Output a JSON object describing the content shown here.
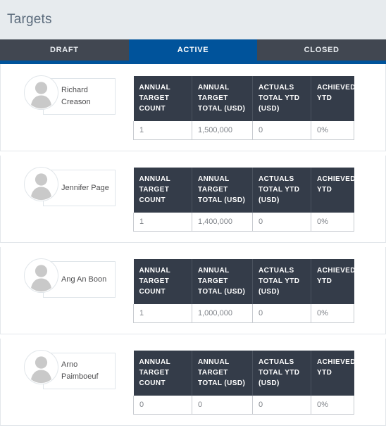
{
  "header": {
    "title": "Targets"
  },
  "tabs": [
    {
      "label": "DRAFT",
      "active": false
    },
    {
      "label": "ACTIVE",
      "active": true
    },
    {
      "label": "CLOSED",
      "active": false
    }
  ],
  "table": {
    "columns": [
      "ANNUAL TARGET COUNT",
      "ANNUAL TARGET TOTAL (USD)",
      "ACTUALS TOTAL YTD (USD)",
      "ACHIEVED YTD"
    ]
  },
  "records": [
    {
      "name": "Richard Creason",
      "avatar_icon": "person-avatar-icon",
      "annual_target_count": "1",
      "annual_target_total_usd": "1,500,000",
      "actuals_total_ytd_usd": "0",
      "achieved_ytd": "0%"
    },
    {
      "name": "Jennifer Page",
      "avatar_icon": "person-avatar-icon",
      "annual_target_count": "1",
      "annual_target_total_usd": "1,400,000",
      "actuals_total_ytd_usd": "0",
      "achieved_ytd": "0%"
    },
    {
      "name": "Ang An Boon",
      "avatar_icon": "person-avatar-icon",
      "annual_target_count": "1",
      "annual_target_total_usd": "1,000,000",
      "actuals_total_ytd_usd": "0",
      "achieved_ytd": "0%"
    },
    {
      "name": "Arno Paimboeuf",
      "avatar_icon": "person-avatar-icon",
      "annual_target_count": "0",
      "annual_target_total_usd": "0",
      "actuals_total_ytd_usd": "0",
      "achieved_ytd": "0%"
    }
  ],
  "colors": {
    "accent_blue": "#00539b",
    "tab_dark": "#414751",
    "table_header_dark": "#343c49",
    "page_header_bg": "#e7ebee",
    "title_text": "#5b6b7c",
    "cell_text": "#7f8389",
    "name_text": "#4d4d4f",
    "card_border": "#e3e7eb"
  }
}
